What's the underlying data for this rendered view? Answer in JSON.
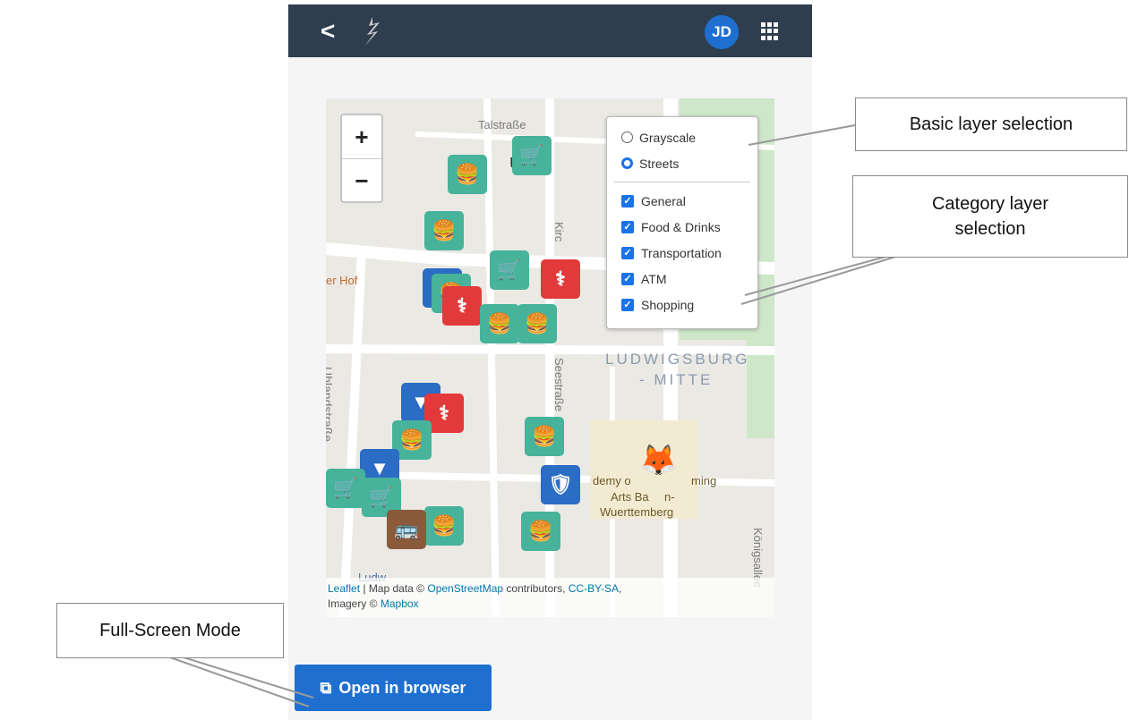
{
  "header": {
    "back_glyph": "<",
    "logo_icon": "winged-logo-icon",
    "avatar_initials": "JD",
    "apps_icon": "grid-icon",
    "bar_color": "#2f3e4f"
  },
  "map": {
    "zoom_in": "+",
    "zoom_out": "−",
    "base_layers": [
      {
        "label": "Grayscale",
        "selected": false
      },
      {
        "label": "Streets",
        "selected": true
      }
    ],
    "category_layers": [
      {
        "label": "General",
        "checked": true
      },
      {
        "label": "Food & Drinks",
        "checked": true
      },
      {
        "label": "Transportation",
        "checked": true
      },
      {
        "label": "ATM",
        "checked": true
      },
      {
        "label": "Shopping",
        "checked": true
      }
    ],
    "labels": {
      "talstrasse": "Talstraße",
      "burg": "urg",
      "hof": "er Hof",
      "uhlandstrasse": "Uhlandstraße",
      "seestrasse": "Seestraße",
      "ludwigsburg": "LUDWIGSBURG",
      "mitte": "- MITTE",
      "academy1": "demy o",
      "academy2": "ming",
      "academy3": "Arts Ba",
      "academy4": "n-",
      "academy5": "Wuerttemberg",
      "ludw": "Ludw",
      "koenigsallee": "Königsallee",
      "kirc": "Kirc"
    },
    "attribution": {
      "leaflet": "Leaflet",
      "mid": " | Map data © ",
      "osm": "OpenStreetMap",
      "contrib": " contributors, ",
      "license": "CC-BY-SA",
      "comma": ",",
      "imagery": "Imagery © ",
      "mapbox": "Mapbox"
    }
  },
  "open_browser_label": "Open in browser",
  "callouts": {
    "basic": "Basic layer selection",
    "category_line1": "Category layer",
    "category_line2": "selection",
    "fullscreen": "Full-Screen Mode"
  },
  "colors": {
    "food": "#47b39b",
    "health": "#e23a3a",
    "atm": "#2b6cc4",
    "bus": "#8a5a3b",
    "button": "#1e6fd0"
  }
}
